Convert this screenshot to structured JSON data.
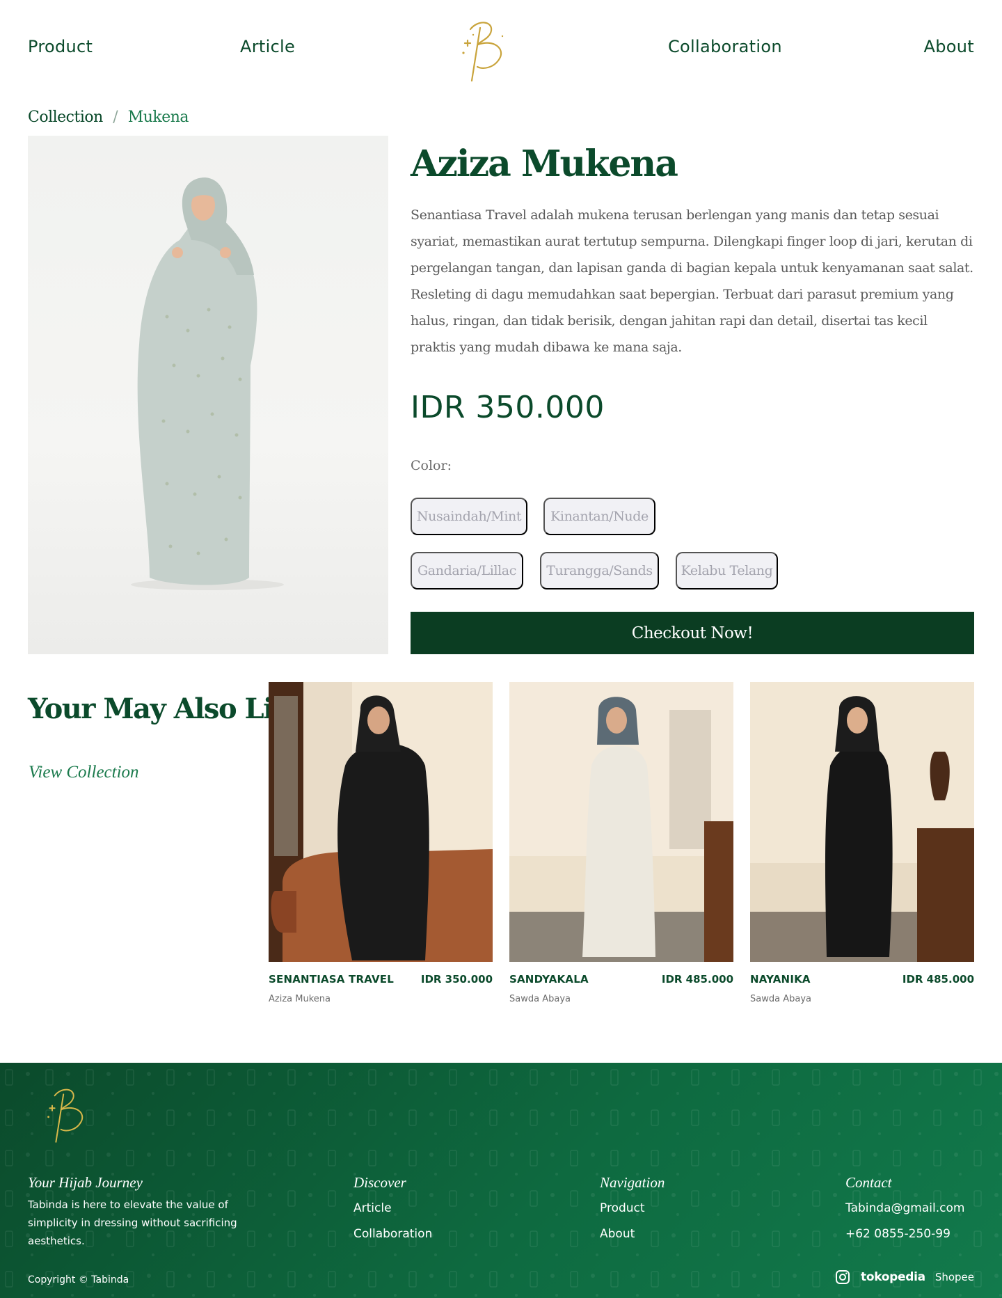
{
  "nav": {
    "product": "Product",
    "article": "Article",
    "collaboration": "Collaboration",
    "about": "About",
    "logo_icon": "tabinda-b-monogram-logo"
  },
  "breadcrumb": {
    "root": "Collection",
    "separator": "/",
    "current": "Mukena"
  },
  "product": {
    "title": "Aziza Mukena",
    "description": "Senantiasa Travel adalah mukena terusan berlengan yang manis dan tetap sesuai syariat, memastikan aurat tertutup sempurna. Dilengkapi finger loop di jari, kerutan di pergelangan tangan, dan lapisan ganda di bagian kepala untuk kenyamanan saat salat. Resleting di dagu memudahkan saat bepergian. Terbuat dari parasut premium yang halus, ringan, dan tidak berisik, dengan jahitan rapi dan detail, disertai tas kecil praktis yang mudah dibawa ke mana saja.",
    "price": "IDR 350.000",
    "color_label": "Color:",
    "colors": [
      "Nusaindah/Mint",
      "Kinantan/Nude",
      "Gandaria/Lillac",
      "Turangga/Sands",
      "Kelabu Telang"
    ],
    "checkout_label": "Checkout Now!"
  },
  "also_like": {
    "title": "Your May Also Like",
    "view_collection": "View Collection",
    "items": [
      {
        "name": "SENANTIASA TRAVEL",
        "price": "IDR 350.000",
        "category": "Aziza Mukena"
      },
      {
        "name": "SANDYAKALA",
        "price": "IDR 485.000",
        "category": "Sawda Abaya"
      },
      {
        "name": "NAYANIKA",
        "price": "IDR 485.000",
        "category": "Sawda Abaya"
      }
    ]
  },
  "footer": {
    "journey_title": "Your Hijab Journey",
    "journey_text": "Tabinda is here to elevate the value of simplicity in dressing without sacrificing aesthetics.",
    "discover_title": "Discover",
    "discover_links": [
      "Article",
      "Collaboration"
    ],
    "navigation_title": "Navigation",
    "navigation_links": [
      "Product",
      "About"
    ],
    "contact_title": "Contact",
    "contact_email": "Tabinda@gmail.com",
    "contact_phone": "+62 0855-250-99",
    "copyright": "Copyright © Tabinda",
    "socials": {
      "instagram_icon": "instagram-icon",
      "tokopedia": "tokopedia",
      "shopee": "Shopee"
    }
  },
  "colors": {
    "brand_green": "#0b4a2b",
    "checkout_green": "#0b3d22",
    "accent_green": "#1a7a4c",
    "logo_gold": "#c9a43c",
    "chip_bg": "#f1f1f5"
  }
}
